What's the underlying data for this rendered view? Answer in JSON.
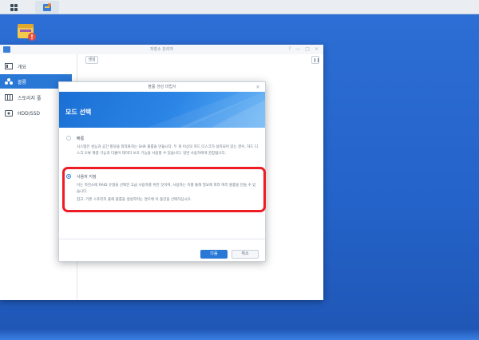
{
  "taskbar": {
    "grid_icon": "apps-grid-icon",
    "app_icon": "storage-manager-icon"
  },
  "window": {
    "title": "저장소 관리자",
    "controls": [
      "?",
      "—",
      "□",
      "×"
    ]
  },
  "sidebar": {
    "items": [
      {
        "label": "개요",
        "icon": "overview-icon"
      },
      {
        "label": "볼륨",
        "icon": "volume-icon"
      },
      {
        "label": "스토리지 풀",
        "icon": "storage-pool-icon"
      },
      {
        "label": "HDD/SSD",
        "icon": "disk-icon"
      }
    ]
  },
  "toolbar": {
    "create_label": "생성"
  },
  "wizard": {
    "title": "볼륨 생성 마법사",
    "heading": "모드 선택",
    "option_quick": {
      "label": "빠름",
      "desc": "시스템은 성능과 공간 할당을 최적화하는 SHR 볼륨을 만듭니다. 두 개 이상의 하드 디스크가 설치되어 있는 경우, 하드 디스크 오류 해결 기능과 더불어 데이터 보호 기능을 사용할 수 있습니다. 일반 사용자에게 권장됩니다."
    },
    "option_custom": {
      "label": "사용자 지정",
      "desc": "이는 자진소에 RAID 유형을 선택한 고급 사용자를 위한 것이며, 사용자는 이를 통해 필요에 따라 여러 볼륨을 만들 수 있습니다.",
      "note": "참고: 기존 스토리지 풀에 볼륨을 생성하려는 경우에 이 옵션을 선택하십시오."
    },
    "next_label": "다음",
    "cancel_label": "취소"
  },
  "colors": {
    "accent": "#2a78d6",
    "highlight": "#ee1c24",
    "desktop": "#2463c9"
  }
}
